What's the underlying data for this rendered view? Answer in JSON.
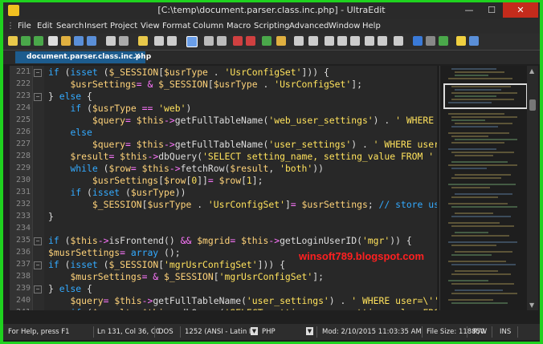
{
  "window": {
    "title": "[C:\\temp\\document.parser.class.inc.php] - UltraEdit",
    "min_glyph": "—",
    "max_glyph": "☐",
    "close_glyph": "✕"
  },
  "menu": [
    "File",
    "Edit",
    "Search",
    "Insert",
    "Project",
    "View",
    "Format",
    "Column",
    "Macro",
    "Scripting",
    "Advanced",
    "Window",
    "Help"
  ],
  "tab": {
    "label": "document.parser.class.inc.php",
    "close": "✕"
  },
  "editor": {
    "lines": [
      {
        "num": "221",
        "text": "if (isset ($_SESSION[$usrType . 'UsrConfigSet'])) {"
      },
      {
        "num": "222",
        "text": "    $usrSettings= & $_SESSION[$usrType . 'UsrConfigSet'];"
      },
      {
        "num": "223",
        "text": "} else {"
      },
      {
        "num": "224",
        "text": "    if ($usrType == 'web')"
      },
      {
        "num": "225",
        "text": "        $query= $this->getFullTableName('web_user_settings') . ' WHERE webus"
      },
      {
        "num": "226",
        "text": "    else"
      },
      {
        "num": "227",
        "text": "        $query= $this->getFullTableName('user_settings') . ' WHERE user=\\''"
      },
      {
        "num": "228",
        "text": "    $result= $this->dbQuery('SELECT setting_name, setting_value FROM ' . $qu"
      },
      {
        "num": "229",
        "text": "    while ($row= $this->fetchRow($result, 'both'))"
      },
      {
        "num": "230",
        "text": "        $usrSettings[$row[0]]= $row[1];"
      },
      {
        "num": "231",
        "text": "    if (isset ($usrType))"
      },
      {
        "num": "232",
        "text": "        $_SESSION[$usrType . 'UsrConfigSet']= $usrSettings; // store user se"
      },
      {
        "num": "233",
        "text": "}"
      },
      {
        "num": "234",
        "text": ""
      },
      {
        "num": "235",
        "text": "if ($this->isFrontend() && $mgrid= $this->getLoginUserID('mgr')) {"
      },
      {
        "num": "236",
        "text": "$musrSettings= array ();"
      },
      {
        "num": "237",
        "text": "if (isset ($_SESSION['mgrUsrConfigSet'])) {"
      },
      {
        "num": "238",
        "text": "    $musrSettings= & $_SESSION['mgrUsrConfigSet'];"
      },
      {
        "num": "239",
        "text": "} else {"
      },
      {
        "num": "240",
        "text": "    $query= $this->getFullTableName('user_settings') . ' WHERE user=\\'' . $m"
      },
      {
        "num": "241",
        "text": "    if ($result= $this->dbQuery('SELECT setting_name, setting_value FROM '"
      }
    ]
  },
  "watermark": "winsoft789.blogspot.com",
  "status": {
    "help": "For Help, press F1",
    "position": "Ln 131, Col 36, C0",
    "line_ending": "DOS",
    "encoding": "1252  (ANSI - Latin I)",
    "language": "PHP",
    "modified": "Mod: 2/10/2015 11:03:35 AM",
    "file_size": "File Size: 118850",
    "rw": "R/W",
    "ins": "INS",
    "dropdown_glyph": "▼"
  },
  "colors": {
    "frame": "#1fd21f",
    "tab_active": "#1d5c8e",
    "keyword": "#33aaff",
    "variable": "#ffd37a",
    "string": "#ffe25c",
    "operator": "#ff77ff",
    "watermark": "#ff2020"
  }
}
